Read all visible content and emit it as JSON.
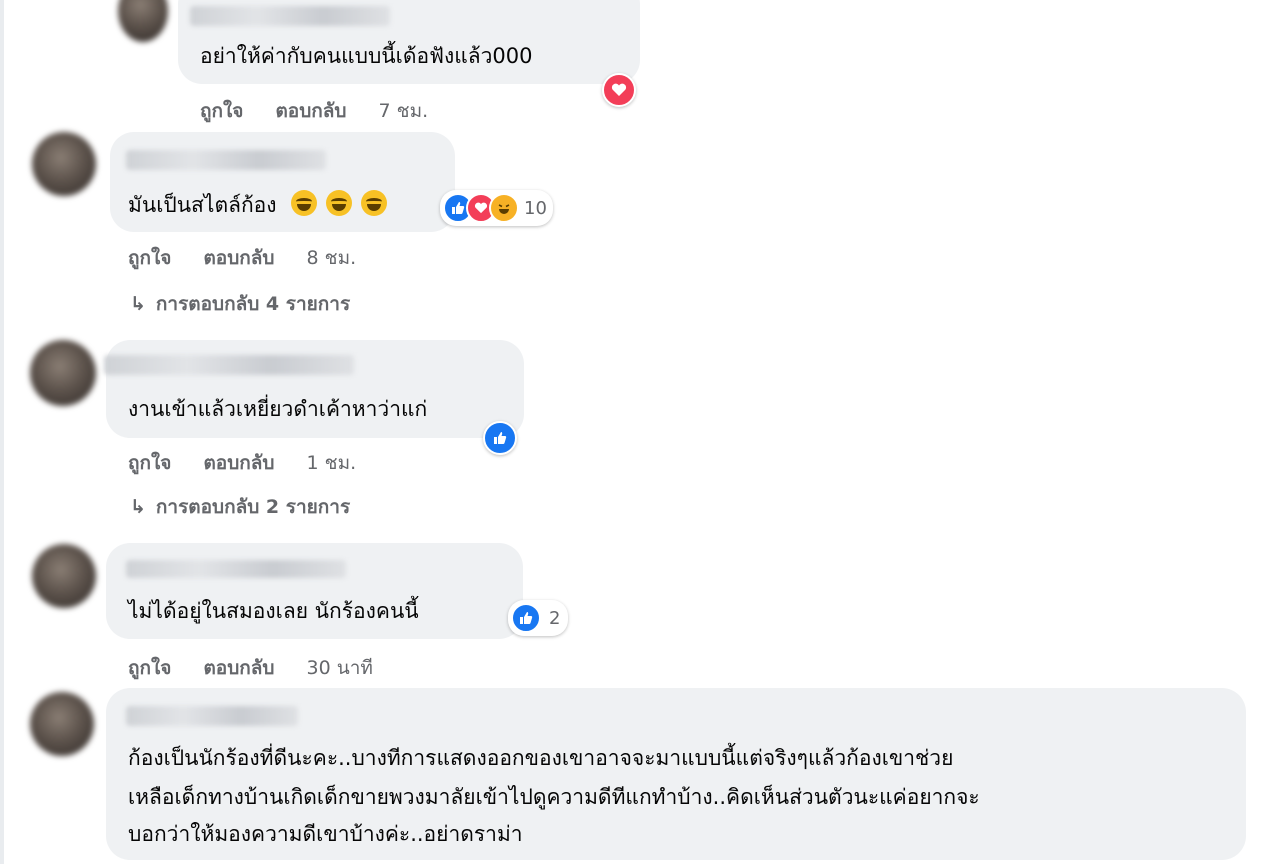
{
  "comments": [
    {
      "text": "อย่าให้ค่ากับคนแบบนี้เด้อฟังแล้ว000",
      "like_label": "ถูกใจ",
      "reply_label": "ตอบกลับ",
      "time": "7 ชม.",
      "reactions": [
        "love-icon"
      ]
    },
    {
      "text": "มันเป็นสไตล์ก้อง",
      "like_label": "ถูกใจ",
      "reply_label": "ตอบกลับ",
      "time": "8 ชม.",
      "reactions": [
        "like-icon",
        "love-icon",
        "haha-icon"
      ],
      "reaction_count": "10",
      "replies_label": "การตอบกลับ 4 รายการ"
    },
    {
      "text": "งานเข้าแล้วเหยี่ยวดำเค้าหาว่าแก่",
      "like_label": "ถูกใจ",
      "reply_label": "ตอบกลับ",
      "time": "1 ชม.",
      "reactions": [
        "like-icon"
      ],
      "replies_label": "การตอบกลับ 2 รายการ"
    },
    {
      "text": "ไม่ได้อยู่ในสมองเลย นักร้องคนนี้",
      "like_label": "ถูกใจ",
      "reply_label": "ตอบกลับ",
      "time": "30 นาที",
      "reactions": [
        "like-icon"
      ],
      "reaction_count": "2"
    },
    {
      "lines": [
        "ก้องเป็นนักร้องที่ดีนะคะ..บางทีการแสดงออกของเขาอาจจะมาแบบนี้แต่จริงๆแล้วก้องเขาช่วย",
        "เหลือเด็กทางบ้านเกิดเด็กขายพวงมาลัยเข้าไปดูความดีทีแกทำบ้าง..คิดเห็นส่วนตัวนะแค่อยากจะ",
        "บอกว่าให้มองความดีเขาบ้างค่ะ..อย่าดราม่า"
      ]
    }
  ],
  "colors": {
    "bubble": "#eff1f3",
    "meta_text": "#65676b",
    "like": "#1877f2",
    "love": "#f33e58",
    "haha": "#f7b125"
  }
}
